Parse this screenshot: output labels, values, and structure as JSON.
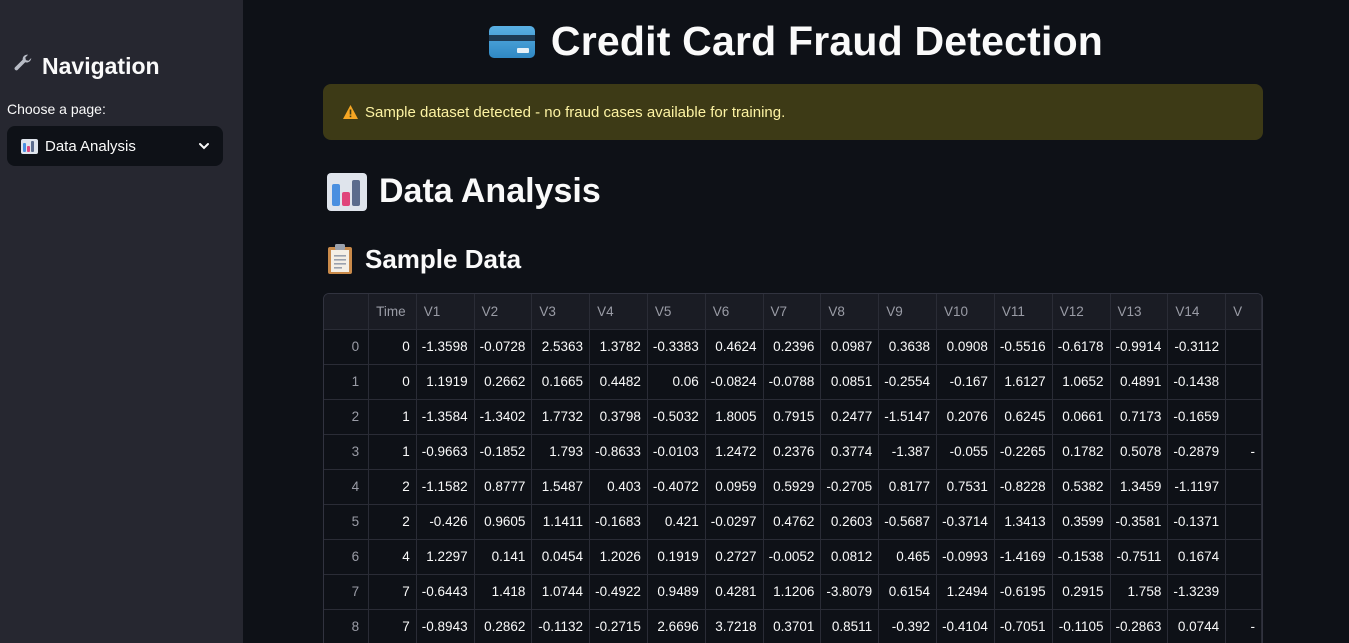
{
  "sidebar": {
    "title": "Navigation",
    "title_icon": "wrench-icon",
    "choose_label": "Choose a page:",
    "select_value": "Data Analysis",
    "select_icon": "bar-chart-icon"
  },
  "main": {
    "title": "Credit Card Fraud Detection",
    "title_icon": "credit-card-icon",
    "warning": "Sample dataset detected - no fraud cases available for training.",
    "warning_icon": "warning-icon",
    "section_title": "Data Analysis",
    "section_icon": "bar-chart-icon",
    "subsection_title": "Sample Data",
    "subsection_icon": "clipboard-icon"
  },
  "table": {
    "columns": [
      "",
      "Time",
      "V1",
      "V2",
      "V3",
      "V4",
      "V5",
      "V6",
      "V7",
      "V8",
      "V9",
      "V10",
      "V11",
      "V12",
      "V13",
      "V14",
      "V"
    ],
    "rows": [
      [
        "0",
        "0",
        "-1.3598",
        "-0.0728",
        "2.5363",
        "1.3782",
        "-0.3383",
        "0.4624",
        "0.2396",
        "0.0987",
        "0.3638",
        "0.0908",
        "-0.5516",
        "-0.6178",
        "-0.9914",
        "-0.3112",
        ""
      ],
      [
        "1",
        "0",
        "1.1919",
        "0.2662",
        "0.1665",
        "0.4482",
        "0.06",
        "-0.0824",
        "-0.0788",
        "0.0851",
        "-0.2554",
        "-0.167",
        "1.6127",
        "1.0652",
        "0.4891",
        "-0.1438",
        ""
      ],
      [
        "2",
        "1",
        "-1.3584",
        "-1.3402",
        "1.7732",
        "0.3798",
        "-0.5032",
        "1.8005",
        "0.7915",
        "0.2477",
        "-1.5147",
        "0.2076",
        "0.6245",
        "0.0661",
        "0.7173",
        "-0.1659",
        ""
      ],
      [
        "3",
        "1",
        "-0.9663",
        "-0.1852",
        "1.793",
        "-0.8633",
        "-0.0103",
        "1.2472",
        "0.2376",
        "0.3774",
        "-1.387",
        "-0.055",
        "-0.2265",
        "0.1782",
        "0.5078",
        "-0.2879",
        "-"
      ],
      [
        "4",
        "2",
        "-1.1582",
        "0.8777",
        "1.5487",
        "0.403",
        "-0.4072",
        "0.0959",
        "0.5929",
        "-0.2705",
        "0.8177",
        "0.7531",
        "-0.8228",
        "0.5382",
        "1.3459",
        "-1.1197",
        ""
      ],
      [
        "5",
        "2",
        "-0.426",
        "0.9605",
        "1.1411",
        "-0.1683",
        "0.421",
        "-0.0297",
        "0.4762",
        "0.2603",
        "-0.5687",
        "-0.3714",
        "1.3413",
        "0.3599",
        "-0.3581",
        "-0.1371",
        ""
      ],
      [
        "6",
        "4",
        "1.2297",
        "0.141",
        "0.0454",
        "1.2026",
        "0.1919",
        "0.2727",
        "-0.0052",
        "0.0812",
        "0.465",
        "-0.0993",
        "-1.4169",
        "-0.1538",
        "-0.7511",
        "0.1674",
        ""
      ],
      [
        "7",
        "7",
        "-0.6443",
        "1.418",
        "1.0744",
        "-0.4922",
        "0.9489",
        "0.4281",
        "1.1206",
        "-3.8079",
        "0.6154",
        "1.2494",
        "-0.6195",
        "0.2915",
        "1.758",
        "-1.3239",
        ""
      ],
      [
        "8",
        "7",
        "-0.8943",
        "0.2862",
        "-0.1132",
        "-0.2715",
        "2.6696",
        "3.7218",
        "0.3701",
        "0.8511",
        "-0.392",
        "-0.4104",
        "-0.7051",
        "-0.1105",
        "-0.2863",
        "0.0744",
        "-"
      ]
    ]
  },
  "colors": {
    "background": "#0e1117",
    "sidebar": "#262730",
    "warning_bg": "#3d3a16",
    "warning_text": "#fdf3a3"
  }
}
